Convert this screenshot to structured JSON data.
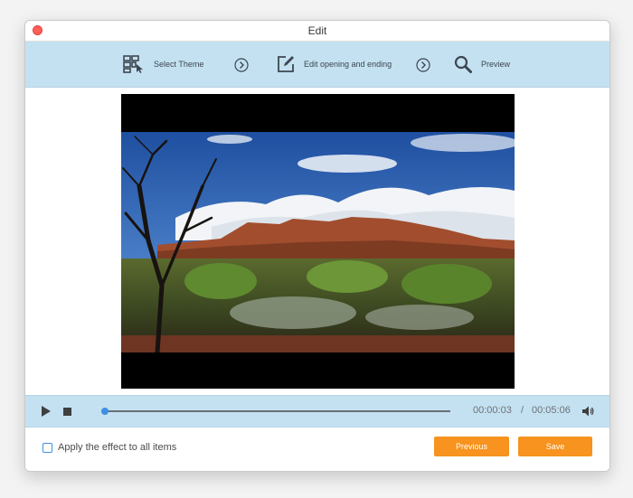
{
  "window": {
    "title": "Edit"
  },
  "steps": [
    {
      "label": "Select Theme",
      "icon": "grid-cursor-icon"
    },
    {
      "label": "Edit opening and ending",
      "icon": "edit-square-icon"
    },
    {
      "label": "Preview",
      "icon": "magnifier-icon"
    }
  ],
  "player": {
    "current_time": "00:00:03",
    "separator": "/",
    "total_time": "00:05:06",
    "progress": 0.01
  },
  "footer": {
    "apply_all_label": "Apply the effect to all items",
    "apply_all_checked": false,
    "previous_label": "Previous",
    "save_label": "Save"
  },
  "colors": {
    "toolbar_bg": "#c4e1f1",
    "accent_orange": "#f7931e",
    "accent_blue": "#3d8fe3",
    "close_red": "#fe5f57"
  }
}
